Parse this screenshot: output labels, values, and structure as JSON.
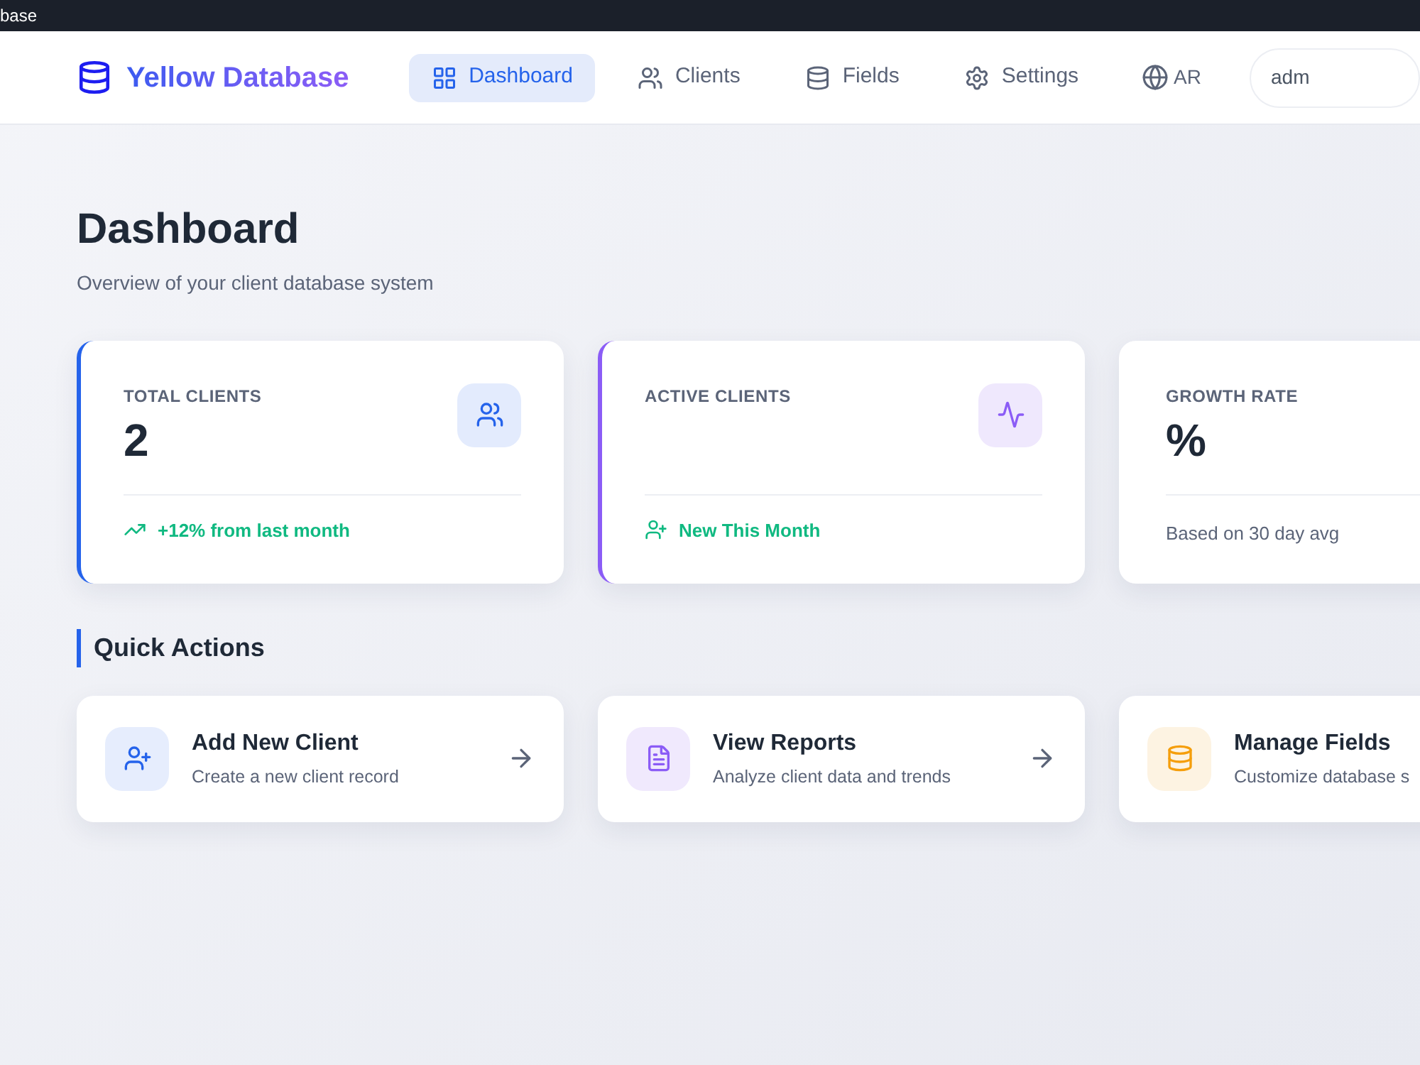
{
  "browser_title": "base",
  "app": {
    "title": "Yellow Database"
  },
  "nav": [
    {
      "label": "Dashboard",
      "kind": "grid",
      "selected": true
    },
    {
      "label": "Clients",
      "kind": "users",
      "selected": false
    },
    {
      "label": "Fields",
      "kind": "database",
      "selected": false
    },
    {
      "label": "Settings",
      "kind": "gear",
      "selected": false
    }
  ],
  "language": "AR",
  "user": "adm",
  "page": {
    "title": "Dashboard",
    "subtitle": "Overview of your client database system"
  },
  "stats": [
    {
      "label": "TOTAL CLIENTS",
      "value": "2",
      "kind": "total",
      "color": "#2563eb",
      "footer": "+12% from last month"
    },
    {
      "label": "ACTIVE CLIENTS",
      "kind": "active",
      "color": "#8b5cf6",
      "footer": "New This Month"
    },
    {
      "label": "GROWTH RATE",
      "value": "%",
      "kind": "growth",
      "footer": "Based on 30 day avg"
    }
  ],
  "quick_actions_title": "Quick Actions",
  "quick_actions": [
    {
      "title": "Add New Client",
      "description": "Create a new client record",
      "kind": "user_plus"
    },
    {
      "title": "View Reports",
      "description": "Analyze client data and trends",
      "kind": "file"
    },
    {
      "title": "Manage Fields",
      "description": "Customize database s",
      "kind": "database"
    }
  ]
}
